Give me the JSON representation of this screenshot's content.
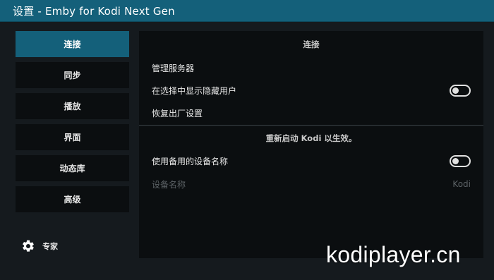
{
  "window": {
    "title": "设置 - Emby for Kodi Next Gen"
  },
  "sidebar": {
    "items": [
      {
        "label": "连接"
      },
      {
        "label": "同步"
      },
      {
        "label": "播放"
      },
      {
        "label": "界面"
      },
      {
        "label": "动态库"
      },
      {
        "label": "高级"
      }
    ],
    "active_index": 0,
    "level": {
      "label": "专家",
      "icon": "gear-icon"
    }
  },
  "content": {
    "section1_title": "连接",
    "manage_servers": "管理服务器",
    "show_hidden_users": {
      "label": "在选择中显示隐藏用户",
      "enabled": false
    },
    "factory_reset": "恢复出厂设置",
    "section2_title": "重新启动 Kodi 以生效。",
    "use_alt_device_name": {
      "label": "使用备用的设备名称",
      "enabled": false
    },
    "device_name": {
      "label": "设备名称",
      "value": "Kodi"
    }
  },
  "watermark": "kodiplayer.cn",
  "colors": {
    "accent": "#14607a",
    "panel": "#0b0e10",
    "background": "#151a1e"
  }
}
